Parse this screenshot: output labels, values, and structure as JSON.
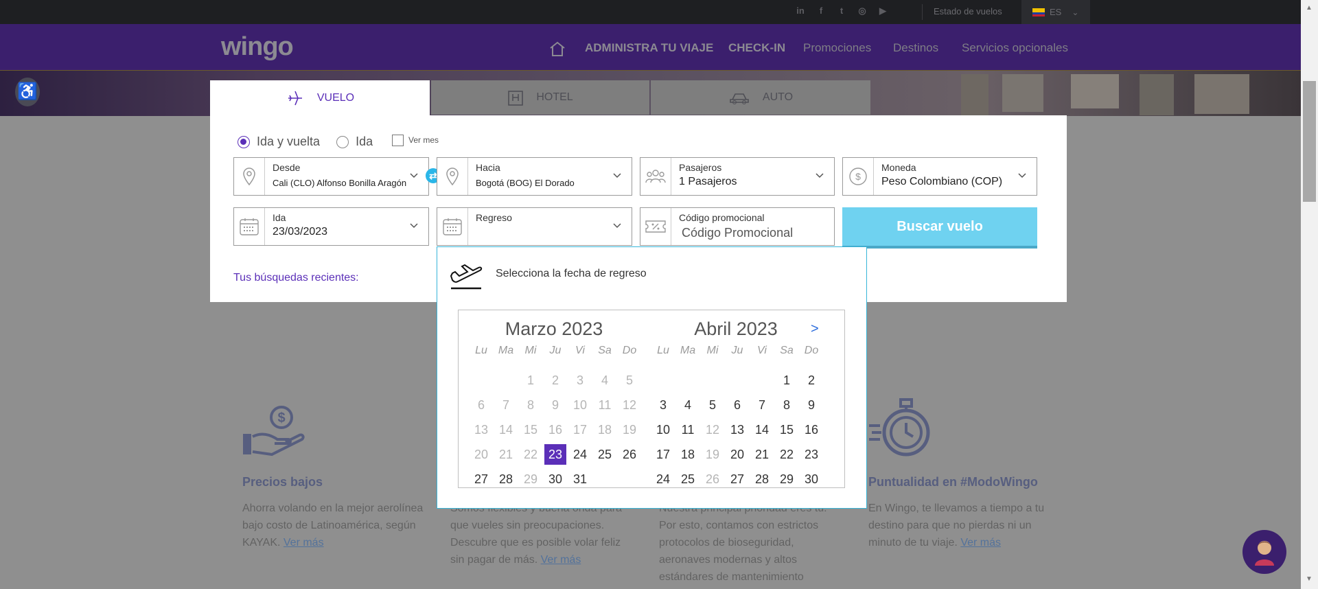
{
  "topbar": {
    "social": [
      "in",
      "f",
      "t",
      "◎",
      "▶"
    ],
    "status_link": "Estado de vuelos",
    "language": "ES"
  },
  "nav": {
    "logo": "wingo",
    "items": [
      "ADMINISTRA TU VIAJE",
      "CHECK-IN",
      "Promociones",
      "Destinos",
      "Servicios opcionales"
    ]
  },
  "tabs": {
    "flight": "VUELO",
    "hotel": "HOTEL",
    "car": "AUTO"
  },
  "form": {
    "trip_round": "Ida y vuelta",
    "trip_oneway": "Ida",
    "see_month": "Ver mes",
    "from_label": "Desde",
    "from_value": "Cali (CLO) Alfonso Bonilla Aragón",
    "to_label": "Hacia",
    "to_value": "Bogotá (BOG) El Dorado",
    "pax_label": "Pasajeros",
    "pax_value": "1 Pasajeros",
    "currency_label": "Moneda",
    "currency_value": "Peso Colombiano (COP)",
    "depart_label": "Ida",
    "depart_value": "23/03/2023",
    "return_label": "Regreso",
    "return_value": "",
    "promo_label": "Código promocional",
    "promo_placeholder": "Código Promocional",
    "search_button": "Buscar vuelo",
    "recent": "Tus búsquedas recientes:"
  },
  "calendar": {
    "prompt": "Selecciona la fecha de regreso",
    "next": ">",
    "weekdays": [
      "Lu",
      "Ma",
      "Mi",
      "Ju",
      "Vi",
      "Sa",
      "Do"
    ],
    "months": [
      {
        "name": "Marzo 2023",
        "offset": 2,
        "days": 31,
        "selected": 23,
        "disabled_until": 22,
        "disabled_extra": [
          29
        ]
      },
      {
        "name": "Abril 2023",
        "offset": 5,
        "days": 30,
        "selected": null,
        "disabled_until": 0,
        "disabled_extra": [
          12,
          19,
          26
        ]
      }
    ]
  },
  "features": [
    {
      "title": "Precios bajos",
      "text": "Ahorra volando en la mejor aerolínea bajo costo de Latinoamérica, según KAYAK.",
      "link": "Ver más"
    },
    {
      "title": "",
      "text": "Somos flexibles y buena onda para que vueles sin preocupaciones. Descubre que es posible volar feliz sin pagar de más.",
      "link": "Ver más"
    },
    {
      "title": "",
      "text": "Nuestra principal prioridad eres tú. Por esto, contamos con estrictos protocolos de bioseguridad, aeronaves modernas y altos estándares de mantenimiento",
      "link": ""
    },
    {
      "title": "Puntualidad en #ModoWingo",
      "text": "En Wingo, te llevamos a tiempo a tu destino para que no pierdas ni un minuto de tu viaje.",
      "link": "Ver más"
    }
  ],
  "colors": {
    "brand_purple": "#5b2fb8",
    "accent_cyan": "#6fd2f0",
    "feature_blue": "#12236b"
  }
}
